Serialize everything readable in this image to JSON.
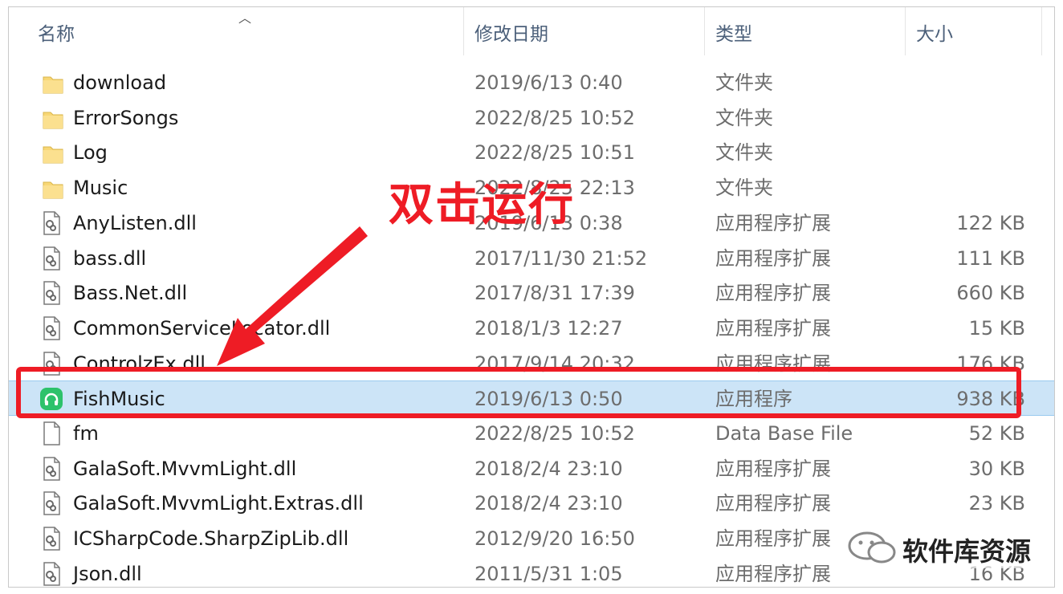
{
  "columns": {
    "name": "名称",
    "date": "修改日期",
    "type": "类型",
    "size": "大小"
  },
  "files": [
    {
      "name": "download",
      "date": "2019/6/13 0:40",
      "type": "文件夹",
      "size": "",
      "icon": "folder-icon"
    },
    {
      "name": "ErrorSongs",
      "date": "2022/8/25 10:52",
      "type": "文件夹",
      "size": "",
      "icon": "folder-icon"
    },
    {
      "name": "Log",
      "date": "2022/8/25 10:51",
      "type": "文件夹",
      "size": "",
      "icon": "folder-icon"
    },
    {
      "name": "Music",
      "date": "2022/8/25 22:13",
      "type": "文件夹",
      "size": "",
      "icon": "folder-icon"
    },
    {
      "name": "AnyListen.dll",
      "date": "2019/6/13 0:38",
      "type": "应用程序扩展",
      "size": "122 KB",
      "icon": "dll-file-icon"
    },
    {
      "name": "bass.dll",
      "date": "2017/11/30 21:52",
      "type": "应用程序扩展",
      "size": "111 KB",
      "icon": "dll-file-icon"
    },
    {
      "name": "Bass.Net.dll",
      "date": "2017/8/31 17:39",
      "type": "应用程序扩展",
      "size": "660 KB",
      "icon": "dll-file-icon"
    },
    {
      "name": "CommonServiceLocator.dll",
      "date": "2018/1/3 12:27",
      "type": "应用程序扩展",
      "size": "15 KB",
      "icon": "dll-file-icon"
    },
    {
      "name": "ControlzEx.dll",
      "date": "2017/9/14 20:32",
      "type": "应用程序扩展",
      "size": "176 KB",
      "icon": "dll-file-icon"
    },
    {
      "name": "FishMusic",
      "date": "2019/6/13 0:50",
      "type": "应用程序",
      "size": "938 KB",
      "icon": "headphones-app-icon"
    },
    {
      "name": "fm",
      "date": "2022/8/25 10:52",
      "type": "Data Base File",
      "size": "52 KB",
      "icon": "file-icon"
    },
    {
      "name": "GalaSoft.MvvmLight.dll",
      "date": "2018/2/4 23:10",
      "type": "应用程序扩展",
      "size": "30 KB",
      "icon": "dll-file-icon"
    },
    {
      "name": "GalaSoft.MvvmLight.Extras.dll",
      "date": "2018/2/4 23:10",
      "type": "应用程序扩展",
      "size": "23 KB",
      "icon": "dll-file-icon"
    },
    {
      "name": "ICSharpCode.SharpZipLib.dll",
      "date": "2012/9/20 16:50",
      "type": "应用程序扩展",
      "size": "",
      "icon": "dll-file-icon"
    },
    {
      "name": "Json.dll",
      "date": "2011/5/31 1:05",
      "type": "应用程序扩展",
      "size": "16 KB",
      "icon": "dll-file-icon"
    }
  ],
  "selected_index": 9,
  "annotation": {
    "text": "双击运行",
    "color": "#ee1c25"
  },
  "watermark": {
    "text": "软件库资源",
    "icon": "wechat-icon"
  },
  "colors": {
    "selection": "#cce4f7",
    "folder": "#f8d775",
    "app_icon": "#2dc26b"
  }
}
